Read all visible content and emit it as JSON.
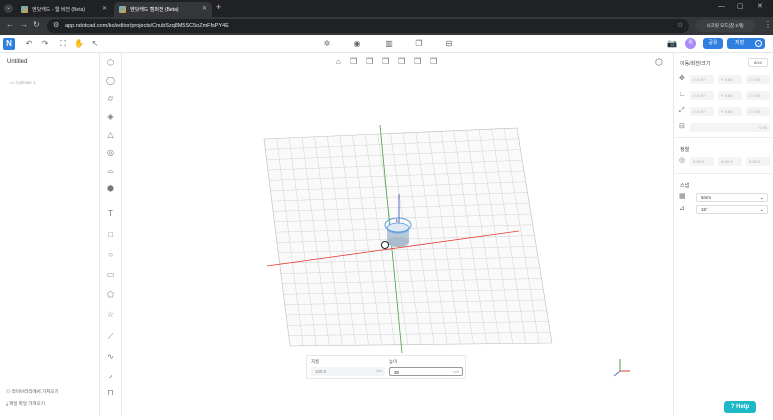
{
  "browser": {
    "tabs": [
      {
        "label": "엔닷캐드 - 웹 버전 (Beta)",
        "active": false
      },
      {
        "label": "엔닷캐드 캠퍼전 (Beta)",
        "active": true
      }
    ],
    "new_tab": "+",
    "url": "app.ndotcad.com/ko/editor/projects/CnubSzq8M5SC5oZmFfsPY4E",
    "profile_label": "시크릿 모드(창 2개)",
    "icons": [
      "back-icon",
      "forward-icon",
      "reload-icon",
      "site-info-icon",
      "bookmark-star-icon",
      "extensions-icon",
      "menu-icon",
      "tab-search-icon"
    ]
  },
  "app": {
    "logo": "N",
    "avatar": "위",
    "share_label": "공유",
    "save_label": "저장",
    "accent": "#2f7fe0"
  },
  "left_panel": {
    "title": "Untitled",
    "item": "Cylinder 1",
    "bottom_links": [
      "라이브러리에서 가져오기",
      "파일 파일 가져오기"
    ]
  },
  "right_panel": {
    "section_transform": "이동/회전/크기",
    "transform_button": "8/10",
    "fields": {
      "x": "X 0.00",
      "y": "Y 0.00",
      "z": "Z 0.00",
      "rx": "X 0.00",
      "ry": "Y 0.00",
      "rz": "Z 0.00",
      "sx": "X 0.00",
      "sy": "Y 0.00",
      "sz": "Z 0.00",
      "bottom": "0.00"
    },
    "section_position": "정렬",
    "pos_fields": {
      "x": "0.00 X",
      "y": "0.00 Y",
      "z": "0.00 Z"
    },
    "section_snap": "스냅",
    "snap_values": [
      "5mm",
      "15°"
    ]
  },
  "dimension_box": {
    "label_diameter": "지름",
    "value_diameter": "100.0",
    "unit_diameter": "mm",
    "label_height": "높이",
    "value_height": "30",
    "unit_height": "mm"
  },
  "help": "? Help",
  "colors": {
    "x_axis": "#e53935",
    "y_axis": "#43a047",
    "z_axis": "#5c6bc0",
    "grid": "#c7c7c7",
    "cylinder": "#b9d6f2"
  }
}
